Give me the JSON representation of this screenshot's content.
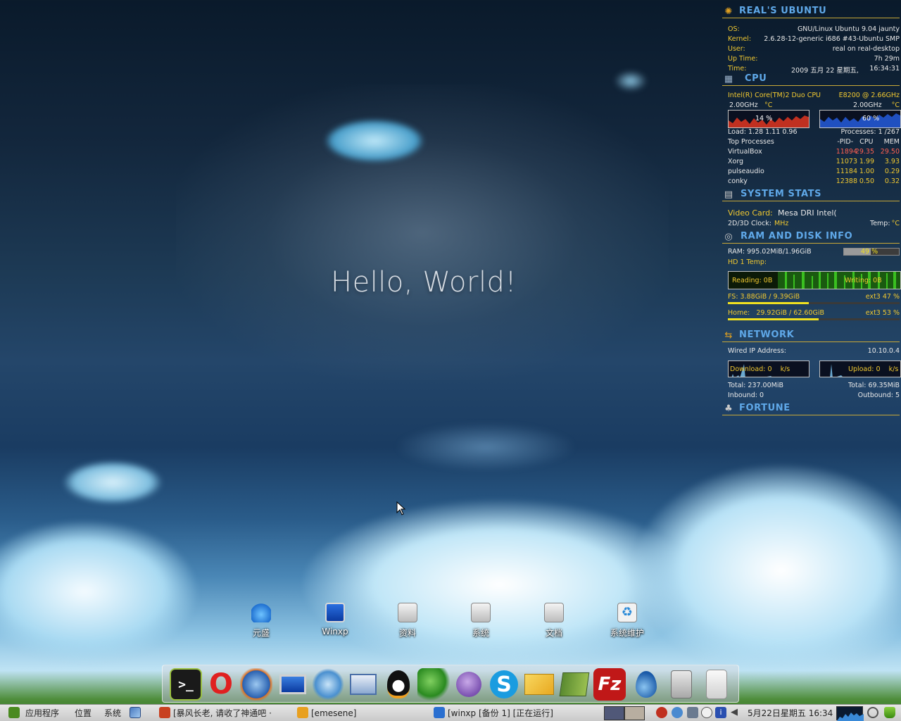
{
  "desktop": {
    "greeting": "Hello, World!",
    "icons": [
      {
        "label": "元盛",
        "icon": "blue-flower-icon"
      },
      {
        "label": "Winxp",
        "icon": "monitor-icon"
      },
      {
        "label": "资料",
        "icon": "drive-icon"
      },
      {
        "label": "系统",
        "icon": "drive-icon"
      },
      {
        "label": "文档",
        "icon": "drive-icon"
      },
      {
        "label": "系统维护",
        "icon": "recycle-icon"
      }
    ]
  },
  "conky": {
    "header": {
      "title": "REAL'S UBUNTU",
      "os_label": "OS:",
      "os_value": "GNU/Linux Ubuntu 9.04 jaunty",
      "kernel_label": "Kernel:",
      "kernel_value": "2.6.28-12-generic i686 #43-Ubuntu SMP",
      "user_label": "User:",
      "user_value": "real on real-desktop",
      "uptime_label": "Up Time:",
      "uptime_value": "7h 29m",
      "time_label": "Time:",
      "time_date": "2009 五月 22 星期五,",
      "time_clock": "16:34:31"
    },
    "cpu": {
      "title": "CPU",
      "model": "Intel(R) Core(TM)2 Duo CPU",
      "model_right": "E8200 @ 2.66GHz",
      "core1_freq": "2.00GHz",
      "core1_unit": "°C",
      "core2_freq": "2.00GHz",
      "core2_unit": "°C",
      "core1_usage": "14 %",
      "core2_usage": "60 %",
      "core1_fraction": 0.14,
      "core2_fraction": 0.6,
      "load": "Load: 1.28 1.11 0.96",
      "processes": "Processes: 1 /267",
      "top_label": "Top Processes",
      "top_cols": "-PID-   CPU     MEM",
      "procs": [
        {
          "name": "VirtualBox",
          "pid": "11894",
          "cpu": "29.35",
          "mem": "29.50"
        },
        {
          "name": "Xorg",
          "pid": "11073",
          "cpu": "1.99",
          "mem": "3.93"
        },
        {
          "name": "pulseaudio",
          "pid": "11184",
          "cpu": "1.00",
          "mem": "0.29"
        },
        {
          "name": "conky",
          "pid": "12388",
          "cpu": "0.50",
          "mem": "0.32"
        }
      ]
    },
    "system": {
      "title": "SYSTEM STATS",
      "video_label": "Video Card:",
      "video_value": "Mesa DRI Intel(",
      "clock_label": "2D/3D Clock:",
      "clock_unit": "MHz",
      "temp_label": "Temp:",
      "temp_unit": "°C"
    },
    "ram": {
      "title": "RAM AND DISK INFO",
      "ram_text": "RAM: 995.02MiB/1.96GiB",
      "ram_percent": "49 %",
      "ram_fraction": 0.49,
      "hd_temp": "HD 1 Temp:",
      "reading": "Reading: 0B",
      "writing": "Writing: 0B",
      "fs_text": "FS: 3.88GiB  / 9.39GiB",
      "fs_type": "ext3 47 %",
      "fs_fraction": 0.47,
      "home_text": "Home:   29.92GiB / 62.60GiB",
      "home_type": "ext3 53 %",
      "home_fraction": 0.53
    },
    "network": {
      "title": "NETWORK",
      "ip_label": "Wired IP Address:",
      "ip_value": "10.10.0.4",
      "download": "Download: 0    k/s",
      "upload": "Upload: 0    k/s",
      "total_down": "Total: 237.00MiB",
      "total_up": "Total: 69.35MiB",
      "inbound": "Inbound: 0",
      "outbound": "Outbound: 5"
    },
    "fortune": {
      "title": "FORTUNE"
    }
  },
  "dock": {
    "items": [
      "terminal-icon",
      "opera-icon",
      "firefox-icon",
      "display-icon",
      "network-globe-icon",
      "remote-desktop-icon",
      "qq-icon",
      "messenger-icon",
      "pidgin-icon",
      "skype-icon",
      "mail-icon",
      "books-icon",
      "filezilla-icon",
      "drop-icon",
      "hard-disk-icon",
      "ipod-icon"
    ]
  },
  "taskbar": {
    "applications": "应用程序",
    "places": "位置",
    "system": "系统",
    "windows": [
      "[暴风长老, 请收了神通吧 ·",
      "[emesene]",
      "[winxp [备份 1] [正在运行]"
    ],
    "clock": "5月22日星期五 16:34"
  }
}
